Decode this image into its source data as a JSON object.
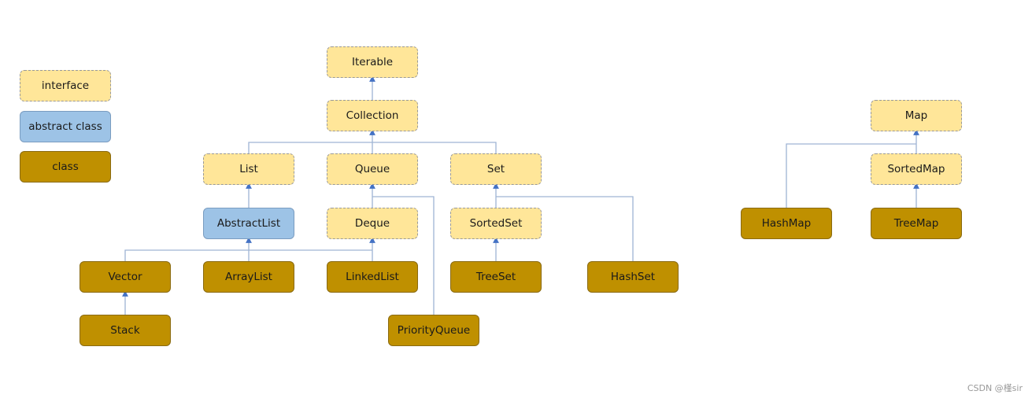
{
  "legend": {
    "interface": "interface",
    "abstract": "abstract class",
    "class": "class"
  },
  "nodes": {
    "iterable": "Iterable",
    "collection": "Collection",
    "list": "List",
    "queue": "Queue",
    "set": "Set",
    "abstractlist": "AbstractList",
    "deque": "Deque",
    "sortedset": "SortedSet",
    "vector": "Vector",
    "arraylist": "ArrayList",
    "linkedlist": "LinkedList",
    "treeset": "TreeSet",
    "hashset": "HashSet",
    "stack": "Stack",
    "priorityqueue": "PriorityQueue",
    "map": "Map",
    "sortedmap": "SortedMap",
    "hashmap": "HashMap",
    "treemap": "TreeMap"
  },
  "colors": {
    "interface": "#ffe699",
    "abstract_class": "#9dc3e6",
    "class": "#bf9000",
    "connector": "#9fb4d4"
  },
  "watermark": "CSDN @槿sir"
}
